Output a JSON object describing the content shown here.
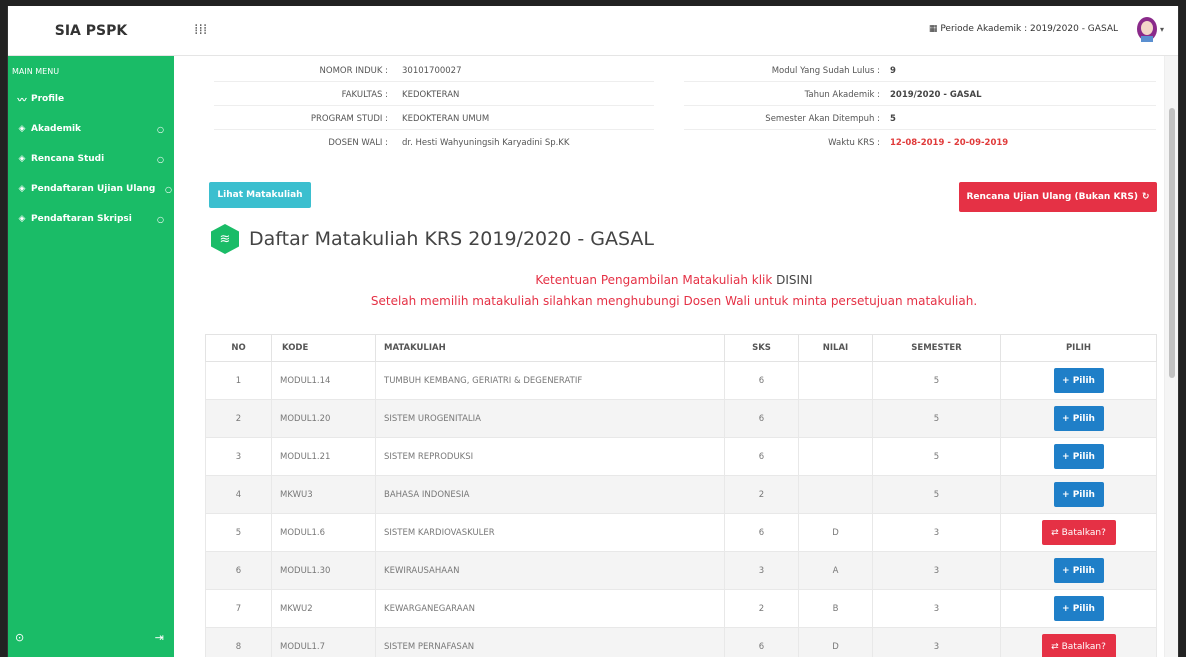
{
  "app": {
    "brand": "SIA PSPK",
    "period_label": "Periode Akademik : 2019/2020 - GASAL"
  },
  "sidebar": {
    "menu_title": "MAIN MENU",
    "items": [
      {
        "label": "Profile",
        "icon": "chart-line-icon",
        "has_dot": false
      },
      {
        "label": "Akademik",
        "icon": "layers-icon",
        "has_dot": true
      },
      {
        "label": "Rencana Studi",
        "icon": "layers-icon",
        "has_dot": true
      },
      {
        "label": "Pendaftaran Ujian Ulang",
        "icon": "layers-icon",
        "has_dot": true
      },
      {
        "label": "Pendaftaran Skripsi",
        "icon": "layers-icon",
        "has_dot": true
      }
    ]
  },
  "student_info": {
    "left": [
      {
        "label": "NOMOR INDUK :",
        "value": "30101700027"
      },
      {
        "label": "FAKULTAS :",
        "value": "KEDOKTERAN"
      },
      {
        "label": "PROGRAM STUDI :",
        "value": "KEDOKTERAN UMUM"
      },
      {
        "label": "DOSEN WALI :",
        "value": "dr. Hesti Wahyuningsih Karyadini Sp.KK"
      }
    ],
    "right": [
      {
        "label": "Modul Yang Sudah Lulus :",
        "value": "9"
      },
      {
        "label": "Tahun Akademik :",
        "value": "2019/2020 - GASAL"
      },
      {
        "label": "Semester Akan Ditempuh :",
        "value": "5"
      },
      {
        "label": "Waktu KRS :",
        "value": "12-08-2019 - 20-09-2019"
      }
    ]
  },
  "buttons": {
    "lihat": "Lihat Matakuliah",
    "rencana": "Rencana Ujian Ulang (Bukan KRS)"
  },
  "heading": "Daftar Matakuliah KRS 2019/2020 - GASAL",
  "notes": {
    "line1_prefix": "Ketentuan Pengambilan Matakuliah klik ",
    "line1_link": "DISINI",
    "line2": "Setelah memilih matakuliah silahkan menghubungi Dosen Wali untuk minta persetujuan matakuliah."
  },
  "table": {
    "headers": [
      "NO",
      "KODE",
      "MATAKULIAH",
      "SKS",
      "NILAI",
      "SEMESTER",
      "PILIH"
    ],
    "rows": [
      {
        "no": "1",
        "kode": "MODUL1.14",
        "matakuliah": "TUMBUH KEMBANG, GERIATRI & DEGENERATIF",
        "sks": "6",
        "nilai": "",
        "semester": "5",
        "action": "+ Pilih",
        "action_type": "pilih"
      },
      {
        "no": "2",
        "kode": "MODUL1.20",
        "matakuliah": "SISTEM UROGENITALIA",
        "sks": "6",
        "nilai": "",
        "semester": "5",
        "action": "+ Pilih",
        "action_type": "pilih"
      },
      {
        "no": "3",
        "kode": "MODUL1.21",
        "matakuliah": "SISTEM REPRODUKSI",
        "sks": "6",
        "nilai": "",
        "semester": "5",
        "action": "+ Pilih",
        "action_type": "pilih"
      },
      {
        "no": "4",
        "kode": "MKWU3",
        "matakuliah": "BAHASA INDONESIA",
        "sks": "2",
        "nilai": "",
        "semester": "5",
        "action": "+ Pilih",
        "action_type": "pilih"
      },
      {
        "no": "5",
        "kode": "MODUL1.6",
        "matakuliah": "SISTEM KARDIOVASKULER",
        "sks": "6",
        "nilai": "D",
        "semester": "3",
        "action": "Batalkan?",
        "action_type": "batal"
      },
      {
        "no": "6",
        "kode": "MODUL1.30",
        "matakuliah": "KEWIRAUSAHAAN",
        "sks": "3",
        "nilai": "A",
        "semester": "3",
        "action": "+ Pilih",
        "action_type": "pilih"
      },
      {
        "no": "7",
        "kode": "MKWU2",
        "matakuliah": "KEWARGANEGARAAN",
        "sks": "2",
        "nilai": "B",
        "semester": "3",
        "action": "+ Pilih",
        "action_type": "pilih"
      },
      {
        "no": "8",
        "kode": "MODUL1.7",
        "matakuliah": "SISTEM PERNAFASAN",
        "sks": "6",
        "nilai": "D",
        "semester": "3",
        "action": "Batalkan?",
        "action_type": "batal"
      }
    ]
  },
  "colors": {
    "sidebar": "#1abc67",
    "primary_button": "#1f7fc8",
    "danger": "#e53145",
    "info": "#3bbfcf"
  }
}
